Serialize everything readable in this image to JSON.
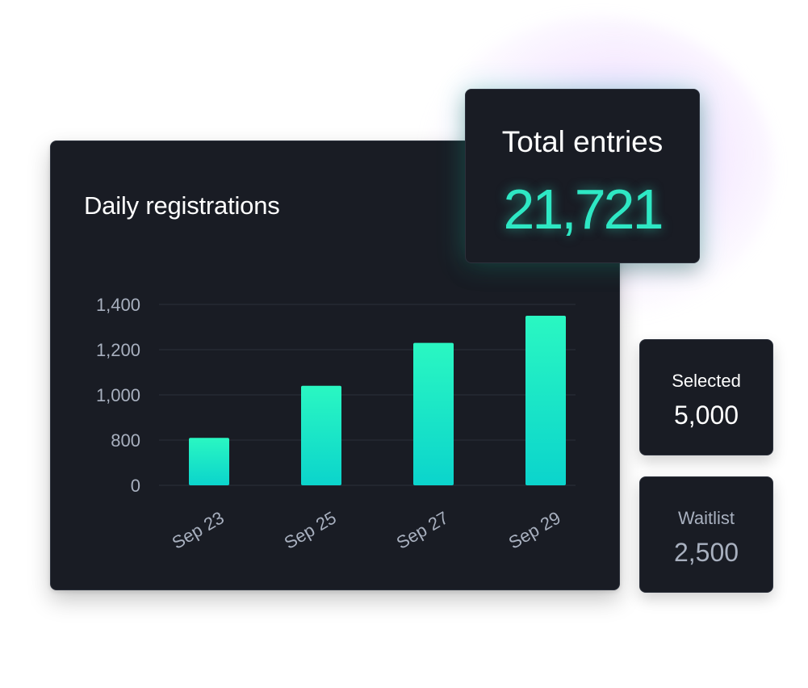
{
  "total": {
    "label": "Total entries",
    "value": "21,721"
  },
  "selected": {
    "label": "Selected",
    "value": "5,000"
  },
  "waitlist": {
    "label": "Waitlist",
    "value": "2,500"
  },
  "colors": {
    "background": "#ffffff",
    "card": "#191c24",
    "accent": "#2ee8c4",
    "bar_top": "#2af7c2",
    "bar_bottom": "#0bd4cc",
    "axis_text": "#a8b0bf",
    "grid": "#2a2f3a"
  },
  "chart_data": {
    "type": "bar",
    "title": "Daily registrations",
    "xlabel": "",
    "ylabel": "",
    "categories": [
      "Sep 23",
      "Sep 25",
      "Sep 27",
      "Sep 29"
    ],
    "values": [
      810,
      1040,
      1230,
      1350
    ],
    "y_ticks": [
      "0",
      "800",
      "1,000",
      "1,200",
      "1,400"
    ],
    "ylim": [
      0,
      1400
    ],
    "grid": true,
    "legend": "none"
  }
}
